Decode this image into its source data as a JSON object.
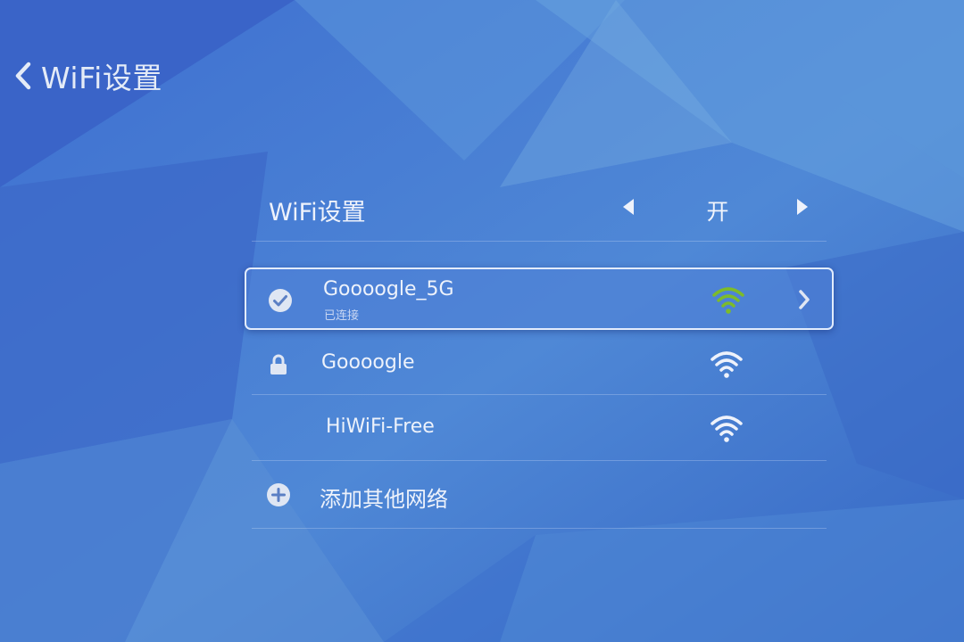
{
  "header": {
    "back_icon": "chevron-left-icon",
    "title": "WiFi设置"
  },
  "wifi_toggle": {
    "label": "WiFi设置",
    "value": "开",
    "prev_icon": "triangle-left-icon",
    "next_icon": "triangle-right-icon"
  },
  "networks": [
    {
      "ssid": "Goooogle_5G",
      "status": "已连接",
      "lead_icon": "check-circle-icon",
      "signal_icon": "wifi-signal-icon",
      "signal_color": "#7dbb2a",
      "selected": true,
      "trailing_icon": "chevron-right-icon"
    },
    {
      "ssid": "Goooogle",
      "status": "",
      "lead_icon": "lock-icon",
      "signal_icon": "wifi-signal-icon",
      "signal_color": "#eef2fb",
      "selected": false
    },
    {
      "ssid": "HiWiFi-Free",
      "status": "",
      "lead_icon": "",
      "signal_icon": "wifi-signal-icon",
      "signal_color": "#eef2fb",
      "selected": false
    }
  ],
  "add_network": {
    "icon": "plus-circle-icon",
    "label": "添加其他网络"
  },
  "colors": {
    "background": "#3d6fc9",
    "accent_green": "#7dbb2a",
    "text": "#edf2fb"
  }
}
